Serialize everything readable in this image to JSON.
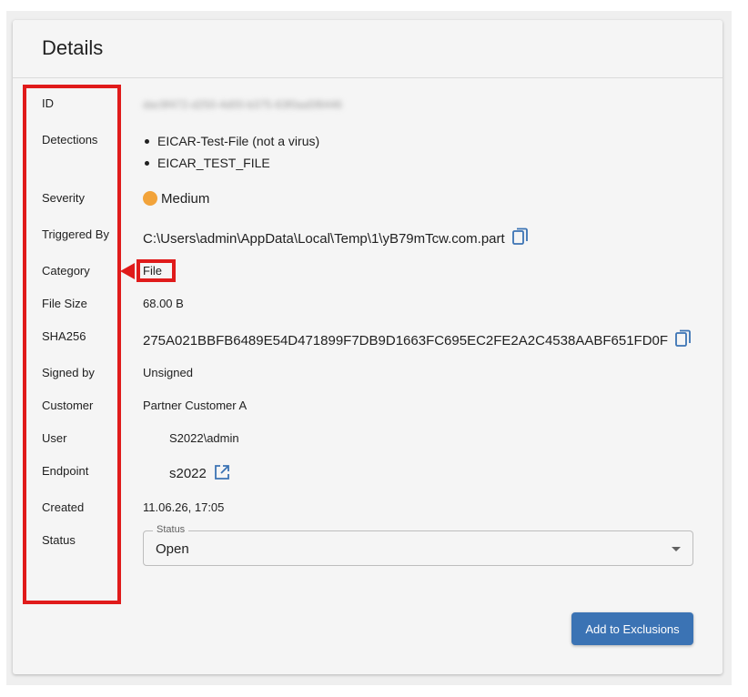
{
  "card": {
    "title": "Details"
  },
  "fields": {
    "id": {
      "label": "ID",
      "value": "dac9f472-d250-4d00-b375-63f0aa5f8446"
    },
    "detections": {
      "label": "Detections",
      "items": [
        "EICAR-Test-File (not a virus)",
        "EICAR_TEST_FILE"
      ]
    },
    "severity": {
      "label": "Severity",
      "value": "Medium",
      "color": "#f2a33a"
    },
    "triggered_by": {
      "label": "Triggered By",
      "value": "C:\\Users\\admin\\AppData\\Local\\Temp\\1\\yB79mTcw.com.part"
    },
    "category": {
      "label": "Category",
      "value": "File"
    },
    "file_size": {
      "label": "File Size",
      "value": "68.00 B"
    },
    "sha256": {
      "label": "SHA256",
      "value": "275A021BBFB6489E54D471899F7DB9D1663FC695EC2FE2A2C4538AABF651FD0F"
    },
    "signed_by": {
      "label": "Signed by",
      "value": "Unsigned"
    },
    "customer": {
      "label": "Customer",
      "value": "Partner Customer A"
    },
    "user": {
      "label": "User",
      "value": "S2022\\admin"
    },
    "endpoint": {
      "label": "Endpoint",
      "value": "s2022"
    },
    "created": {
      "label": "Created",
      "value": "11.06.26, 17:05"
    },
    "status": {
      "label": "Status",
      "legend": "Status",
      "value": "Open"
    }
  },
  "actions": {
    "add_to_exclusions": "Add to Exclusions"
  },
  "colors": {
    "accent": "#3b73b4",
    "annotation": "#e01b1b",
    "severity_medium": "#f2a33a"
  },
  "icons": {
    "copy": "copy-icon",
    "external_link": "external-link-icon",
    "dropdown": "caret-down-icon"
  }
}
